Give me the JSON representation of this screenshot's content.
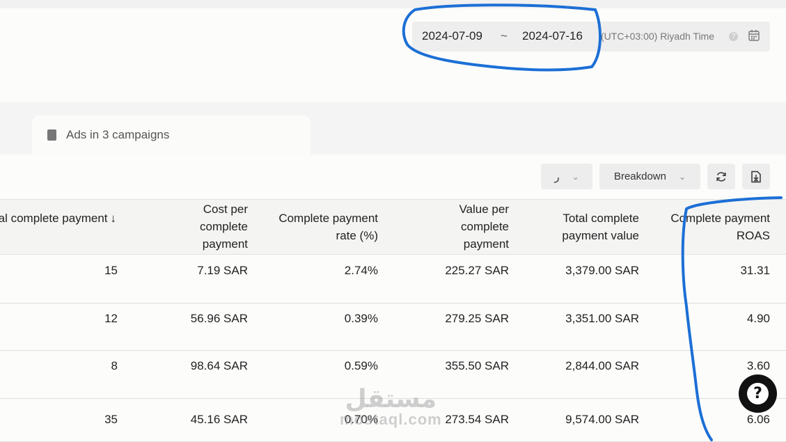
{
  "date_range": {
    "start": "2024-07-09",
    "separator": "~",
    "end": "2024-07-16",
    "timezone": "(UTC+03:00) Riyadh Time",
    "help_glyph": "?",
    "icon": "calendar-icon"
  },
  "tabs": [
    {
      "label": "Ads in 3 campaigns",
      "icon": "ad-tab-icon"
    }
  ],
  "toolbar": {
    "columns_label": "ر",
    "breakdown_label": "Breakdown",
    "refresh_icon": "refresh-icon",
    "export_icon": "download-icon"
  },
  "table": {
    "columns": [
      "Total complete payment",
      "Cost per complete payment",
      "Complete payment rate (%)",
      "Value per complete payment",
      "Total complete payment value",
      "Complete payment ROAS"
    ],
    "sort_indicator": "↓",
    "rows": [
      [
        "15",
        "7.19 SAR",
        "2.74%",
        "225.27 SAR",
        "3,379.00 SAR",
        "31.31"
      ],
      [
        "12",
        "56.96 SAR",
        "0.39%",
        "279.25 SAR",
        "3,351.00 SAR",
        "4.90"
      ],
      [
        "8",
        "98.64 SAR",
        "0.59%",
        "355.50 SAR",
        "2,844.00 SAR",
        "3.60"
      ],
      [
        "35",
        "45.16 SAR",
        "0.70%",
        "273.54 SAR",
        "9,574.00 SAR",
        "6.06"
      ]
    ]
  },
  "help_button": {
    "glyph": "?"
  },
  "watermark": {
    "arabic": "مستقل",
    "latin": "mostaql.com"
  },
  "annotation_color": "#1c6fd6"
}
